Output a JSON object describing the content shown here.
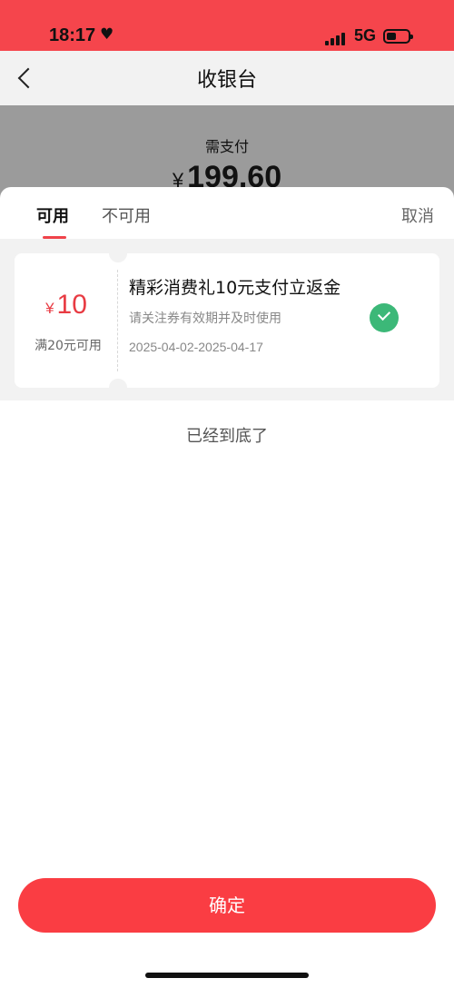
{
  "status_bar": {
    "time": "18:17",
    "heart_glyph": "♥",
    "network": "5G",
    "icons": [
      "heart-icon",
      "signal-icon",
      "battery-icon"
    ]
  },
  "nav": {
    "title": "收银台",
    "back_icon": "back-chevron-icon"
  },
  "payment": {
    "label": "需支付",
    "currency": "¥",
    "amount": "199.60"
  },
  "sheet": {
    "tabs": [
      {
        "label": "可用",
        "active": true
      },
      {
        "label": "不可用",
        "active": false
      }
    ],
    "cancel_label": "取消",
    "coupons": [
      {
        "currency": "¥",
        "amount": "10",
        "condition": "满20元可用",
        "title": "精彩消费礼10元支付立返金",
        "note": "请关注券有效期并及时使用",
        "dates": "2025-04-02-2025-04-17",
        "selected": true
      }
    ],
    "end_text": "已经到底了"
  },
  "confirm_label": "确定",
  "colors": {
    "accent": "#f5454c",
    "button": "#fa3d43",
    "coupon_amount": "#e83b43",
    "check": "#3cb878"
  }
}
